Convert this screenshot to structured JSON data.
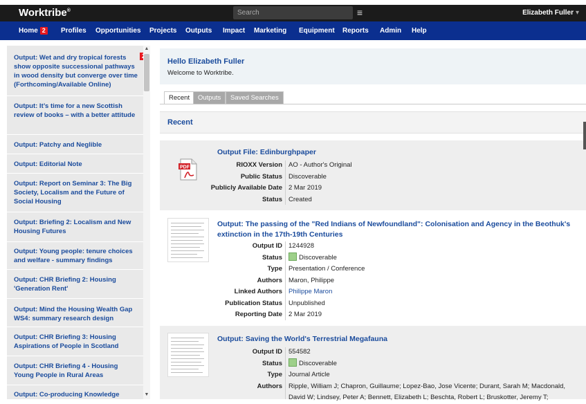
{
  "app": {
    "logo": "Worktribe",
    "logo_mark": "®"
  },
  "topbar": {
    "search_placeholder": "Search",
    "menu_icon": "hamburger-icon",
    "user_name": "Elizabeth Fuller",
    "user_caret": "▾"
  },
  "nav": {
    "items": [
      {
        "label": "Home",
        "badge": "2"
      },
      {
        "label": "Profiles"
      },
      {
        "label": "Opportunities"
      },
      {
        "label": "Projects"
      },
      {
        "label": "Outputs"
      },
      {
        "label": "Impact"
      },
      {
        "label": "Marketing"
      },
      {
        "label": "Equipment"
      },
      {
        "label": "Reports"
      },
      {
        "label": "Admin"
      },
      {
        "label": "Help"
      }
    ]
  },
  "sidebar": {
    "first_badge": "2",
    "items": [
      "Output: Wet and dry tropical forests show opposite successional pathways in wood density but converge over time (Forthcoming/Available Online)",
      "Output: It’s time for a new Scottish review of books – with a better attitude",
      "Output: Patchy and Neglible",
      "Output: Editorial Note",
      "Output: Report on Seminar 3: The Big Society, Localism and the Future of Social Housing",
      "Output: Briefing 2: Localism and New Housing Futures",
      "Output: Young people: tenure choices and welfare - summary findings",
      "Output: CHR Briefing 2: Housing 'Generation Rent'",
      "Output: Mind the Housing Wealth Gap WS4: summary research design",
      "Output: CHR Briefing 3: Housing Aspirations of People in Scotland",
      "Output: CHR Briefing 4 - Housing Young People in Rural Areas",
      "Output: Co-producing Knowledge"
    ]
  },
  "welcome": {
    "title": "Hello Elizabeth Fuller",
    "subtitle": "Welcome to Worktribe."
  },
  "tabs": [
    "Recent",
    "Outputs",
    "Saved Searches"
  ],
  "recent_heading": "Recent",
  "cards": [
    {
      "title": "Output File: Edinburghpaper",
      "thumb_icon": "pdf-file-icon",
      "fields": [
        {
          "k": "RIOXX Version",
          "v": "AO - Author's Original"
        },
        {
          "k": "Public Status",
          "v": "Discoverable"
        },
        {
          "k": "Publicly Available Date",
          "v": "2 Mar 2019"
        },
        {
          "k": "Status",
          "v": "Created"
        }
      ]
    },
    {
      "title": "Output: The passing of the \"Red Indians of Newfoundland\": Colonisation and Agency in the Beothuk's extinction in the 17th-19th Centuries",
      "thumb_icon": "document-thumbnail-icon",
      "fields": [
        {
          "k": "Output ID",
          "v": "1244928"
        },
        {
          "k": "Status",
          "v": "Discoverable"
        },
        {
          "k": "Type",
          "v": "Presentation / Conference"
        },
        {
          "k": "Authors",
          "v": "Maron, Philippe"
        },
        {
          "k": "Linked Authors",
          "v": "Philippe Maron"
        },
        {
          "k": "Publication Status",
          "v": "Unpublished"
        },
        {
          "k": "Reporting Date",
          "v": "2 Mar 2019"
        }
      ]
    },
    {
      "title": "Output: Saving the World's Terrestrial Megafauna",
      "thumb_icon": "document-thumbnail-icon",
      "fields": [
        {
          "k": "Output ID",
          "v": "554582"
        },
        {
          "k": "Status",
          "v": "Discoverable"
        },
        {
          "k": "Type",
          "v": "Journal Article"
        },
        {
          "k": "Authors",
          "v": "Ripple, William J; Chapron, Guillaume; Lopez-Bao, Jose Vicente; Durant, Sarah M; Macdonald,"
        },
        {
          "k": "",
          "v": "David W; Lindsey, Peter A; Bennett, Elizabeth L; Beschta, Robert L; Bruskotter, Jeremy T;"
        }
      ]
    }
  ],
  "colors": {
    "nav_bg": "#0b2f8f",
    "topbar_bg": "#1b1b1b",
    "link": "#1a4b9c",
    "badge": "#e8181e",
    "status_green": "#9ed08a"
  }
}
